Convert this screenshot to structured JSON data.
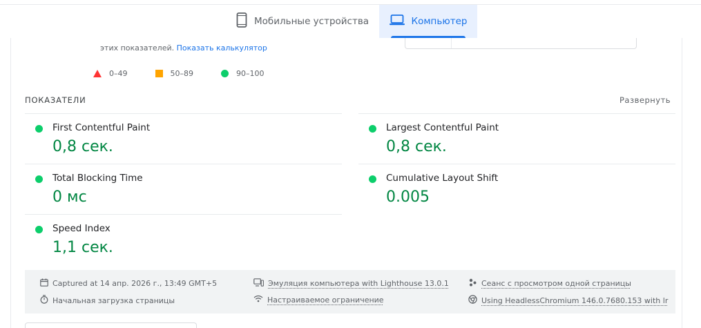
{
  "tabs": {
    "mobile_label": "Мобильные устройства",
    "desktop_label": "Компьютер",
    "active": "desktop"
  },
  "calculator_note": {
    "text": "этих показателей.",
    "link": "Показать калькулятор"
  },
  "legend": [
    {
      "shape": "triangle",
      "color": "#ff3333",
      "label": "0–49"
    },
    {
      "shape": "square",
      "color": "#ffa400",
      "label": "50–89"
    },
    {
      "shape": "circle",
      "color": "#0cce6b",
      "label": "90–100"
    }
  ],
  "metrics_section": {
    "title": "ПОКАЗАТЕЛИ",
    "expand_label": "Развернуть",
    "metrics": [
      {
        "name": "First Contentful Paint",
        "value": "0,8 сек.",
        "status": "good"
      },
      {
        "name": "Largest Contentful Paint",
        "value": "0,8 сек.",
        "status": "good"
      },
      {
        "name": "Total Blocking Time",
        "value": "0 мс",
        "status": "good"
      },
      {
        "name": "Cumulative Layout Shift",
        "value": "0.005",
        "status": "good"
      },
      {
        "name": "Speed Index",
        "value": "1,1 сек.",
        "status": "good"
      }
    ]
  },
  "run_info": {
    "captured": "Captured at 14 апр. 2026 г., 13:49 GMT+5",
    "initial_load": "Начальная загрузка страницы",
    "emulation": "Эмуляция компьютера with Lighthouse 13.0.1",
    "throttling": "Настраиваемое ограничение",
    "session": "Сеанс с просмотром одной страницы",
    "browser": "Using HeadlessChromium 146.0.7680.153 with lr"
  },
  "colors": {
    "accent": "#1a73e8",
    "good": "#0cce6b",
    "good_text": "#018642",
    "average": "#ffa400",
    "poor": "#ff3333"
  }
}
